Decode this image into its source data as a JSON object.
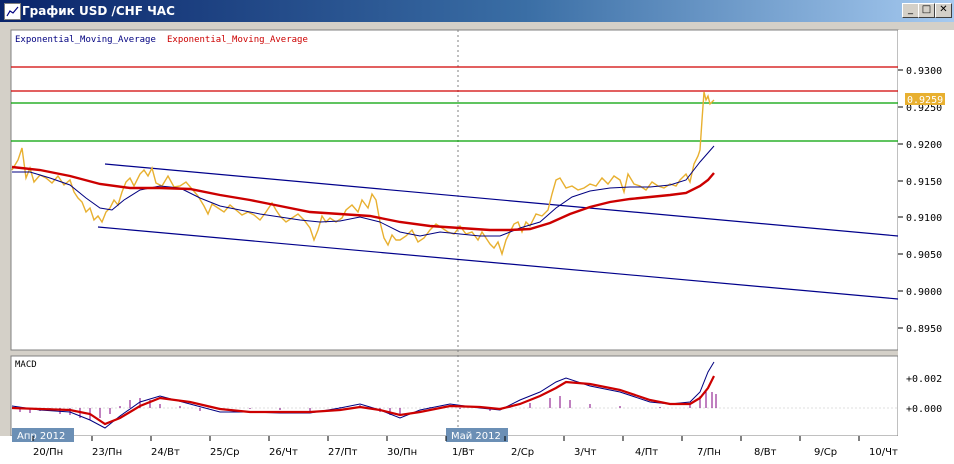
{
  "window": {
    "title": "График USD /CHF ЧАС"
  },
  "colors": {
    "price": "#e8b030",
    "ema_fast": "#000080",
    "ema_slow": "#cc0000",
    "level_red": "#d00000",
    "level_green": "#00a000",
    "channel": "#00008b",
    "histogram": "#800080",
    "bg": "#ffffff"
  },
  "main_chart": {
    "legend": [
      "Exponential_Moving_Average",
      "Exponential_Moving_Average"
    ],
    "price_ticks": [
      "0.9300",
      "0.9250",
      "0.9200",
      "0.9150",
      "0.9100",
      "0.9050",
      "0.9000",
      "0.8950"
    ],
    "current_price": "0.9259"
  },
  "macd": {
    "title": "MACD",
    "ticks": [
      "+0.002",
      "+0.000"
    ]
  },
  "time_axis": {
    "labels": [
      "20/Пн",
      "23/Пн",
      "24/Вт",
      "25/Ср",
      "26/Чт",
      "27/Пт",
      "30/Пн",
      "1/Вт",
      "2/Ср",
      "3/Чт",
      "4/Пт",
      "7/Пн",
      "8/Вт",
      "9/Ср",
      "10/Чт"
    ],
    "month_labels": [
      "Апр 2012",
      "Май 2012"
    ]
  },
  "chart_data": {
    "type": "line",
    "title": "График USD /CHF ЧАС",
    "x": [
      "20/Пн",
      "23/Пн",
      "24/Вт",
      "25/Ср",
      "26/Чт",
      "27/Пт",
      "30/Пн",
      "1/Вт",
      "2/Ср",
      "3/Чт",
      "4/Пт",
      "7/Пн"
    ],
    "series": [
      {
        "name": "USD/CHF",
        "values": [
          0.9165,
          0.9095,
          0.9145,
          0.9125,
          0.911,
          0.9105,
          0.9085,
          0.908,
          0.9065,
          0.9145,
          0.914,
          0.918
        ]
      },
      {
        "name": "Exponential_Moving_Average",
        "values": [
          0.916,
          0.911,
          0.914,
          0.9125,
          0.911,
          0.91,
          0.9088,
          0.9082,
          0.908,
          0.912,
          0.9135,
          0.917
        ]
      },
      {
        "name": "Exponential_Moving_Average",
        "values": [
          0.9165,
          0.915,
          0.914,
          0.913,
          0.9118,
          0.9105,
          0.9095,
          0.9085,
          0.9082,
          0.911,
          0.9125,
          0.9155
        ]
      }
    ],
    "ylim": [
      0.8925,
      0.933
    ],
    "horizontal_levels": [
      0.9303,
      0.9267,
      0.9248,
      0.9203
    ],
    "grid": false
  }
}
